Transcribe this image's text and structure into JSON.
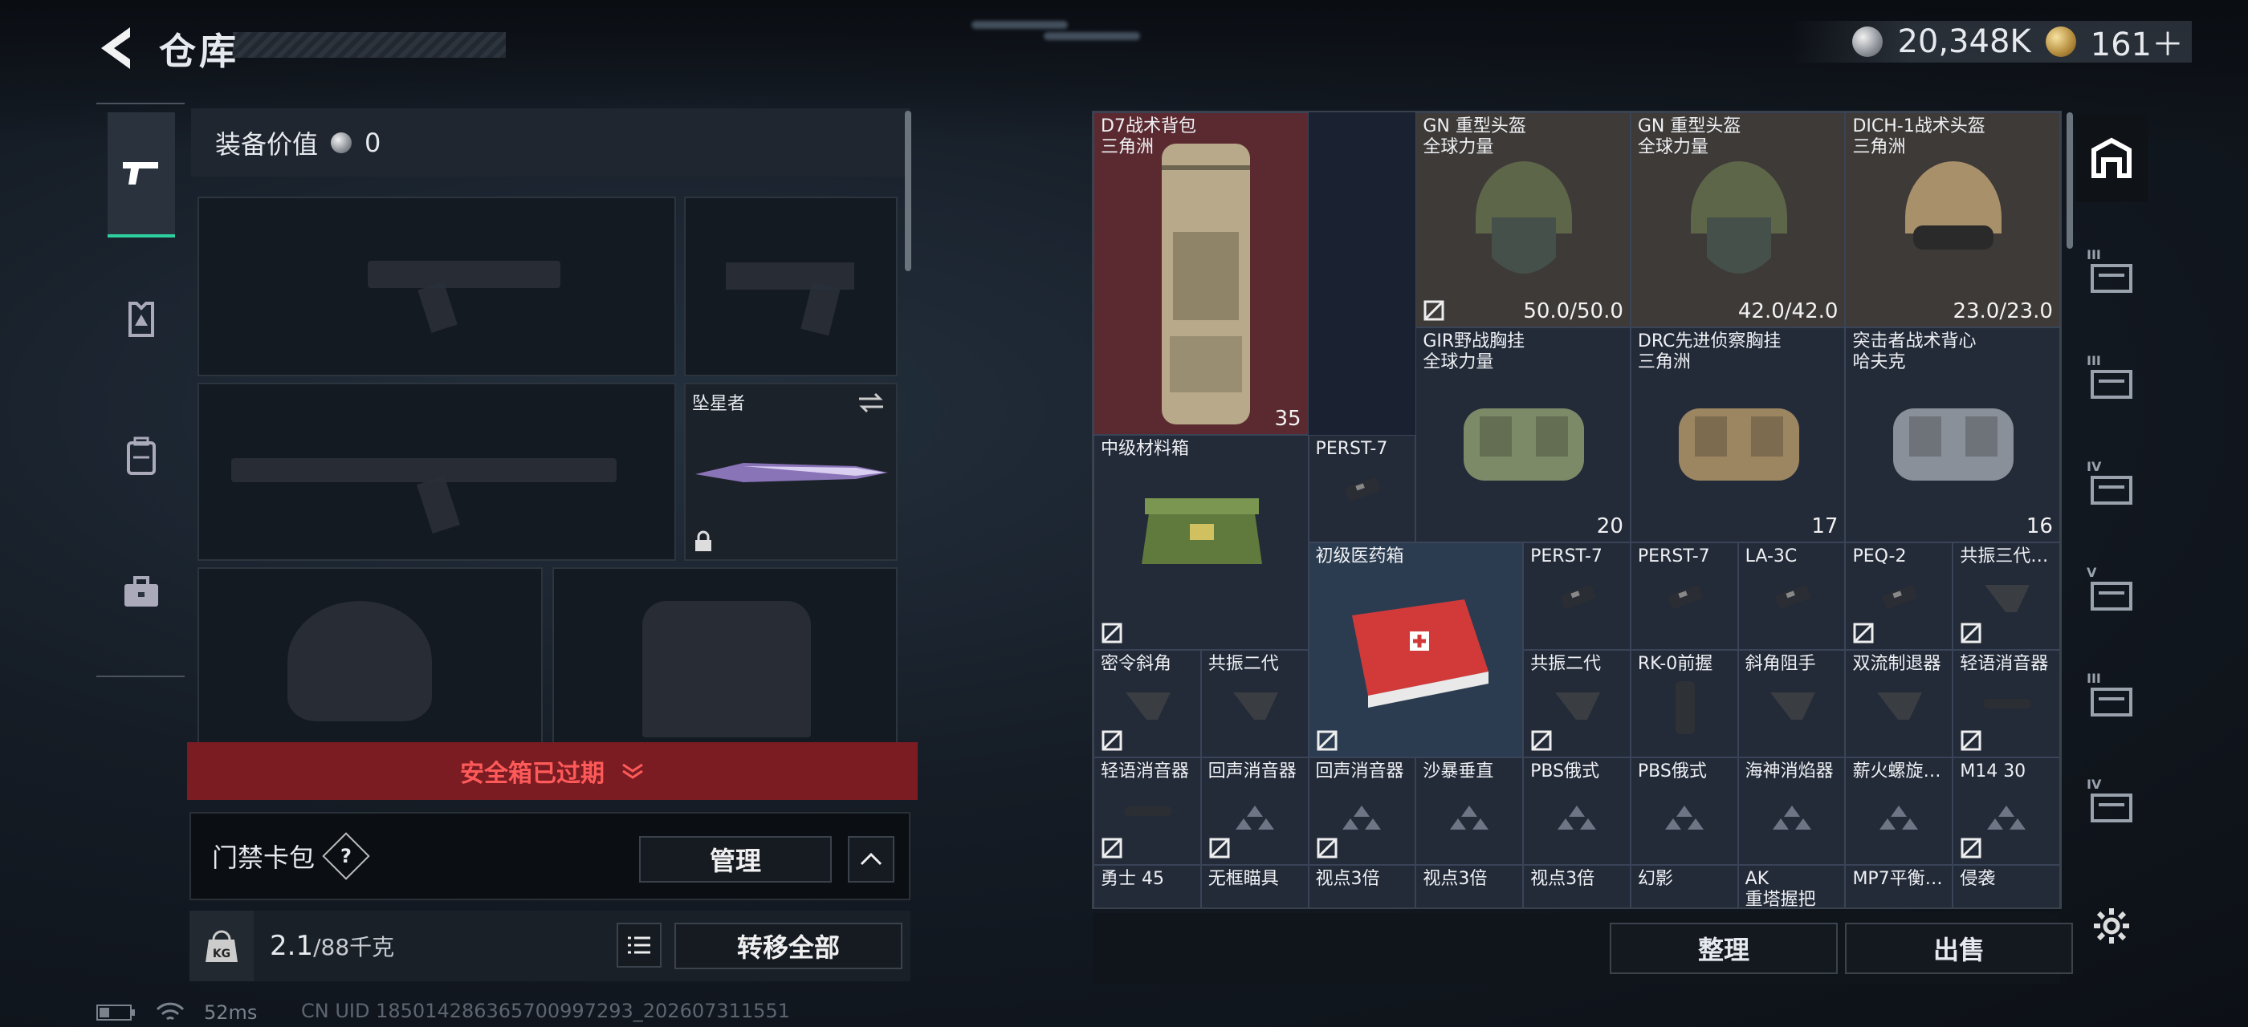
{
  "header": {
    "title": "仓库",
    "silver": "20,348K",
    "gold": "161＋"
  },
  "equipment": {
    "value_label": "装备价值",
    "value": "0",
    "melee_name": "坠星者",
    "safebox_status": "安全箱已过期",
    "card_pack_label": "门禁卡包",
    "help": "?",
    "manage": "管理",
    "weight": "2.1",
    "weight_max": "/88千克",
    "kg_icon": "KG",
    "transfer_all": "转移全部"
  },
  "inventory": {
    "items": [
      {
        "name": "D7战术背包",
        "sub": "三角洲",
        "val": "35"
      },
      {
        "name": "GN 重型头盔",
        "sub": "全球力量",
        "val": "50.0/50.0"
      },
      {
        "name": "GN 重型头盔",
        "sub": "全球力量",
        "val": "42.0/42.0"
      },
      {
        "name": "DICH-1战术头盔",
        "sub": "三角洲",
        "val": "23.0/23.0"
      },
      {
        "name": "GIR野战胸挂",
        "sub": "全球力量"
      },
      {
        "name": "DRC先进侦察胸挂",
        "sub": "三角洲",
        "val": "17"
      },
      {
        "name": "突击者战术背心",
        "sub": "哈夫克",
        "val": "16"
      },
      {
        "name": "中级材料箱"
      },
      {
        "name": "PERST-7"
      },
      {
        "name": "初级医药箱"
      },
      {
        "name": "PERST-7"
      },
      {
        "name": "PERST-7"
      },
      {
        "name": "LA-3C"
      },
      {
        "name": "PEQ-2"
      },
      {
        "name": "共振三代…"
      },
      {
        "name": "密令斜角"
      },
      {
        "name": "共振二代"
      },
      {
        "name": "共振二代"
      },
      {
        "name": "RK-0前握"
      },
      {
        "name": "斜角阻手"
      },
      {
        "name": "双流制退器"
      },
      {
        "name": "轻语消音器"
      },
      {
        "name": "轻语消音器"
      },
      {
        "name": "回声消音器"
      },
      {
        "name": "回声消音器"
      },
      {
        "name": "沙暴垂直"
      },
      {
        "name": "PBS俄式"
      },
      {
        "name": "PBS俄式"
      },
      {
        "name": "海神消焰器"
      },
      {
        "name": "薪火螺旋…"
      },
      {
        "name": "M14 30"
      },
      {
        "name": "勇士 45"
      },
      {
        "name": "无框瞄具"
      },
      {
        "name": "视点3倍"
      },
      {
        "name": "视点3倍"
      },
      {
        "name": "视点3倍"
      },
      {
        "name": "幻影"
      },
      {
        "name": "AK",
        "sub": "重塔握把"
      },
      {
        "name": "MP7平衡…"
      },
      {
        "name": "侵袭"
      }
    ],
    "gir_val": "20",
    "sort": "整理",
    "sell": "出售"
  },
  "right_nav": [
    "III",
    "III",
    "IV",
    "V",
    "III",
    "IV"
  ],
  "status": {
    "ping": "52ms",
    "uid": "CN UID 1850142863657009972​93_202607311551"
  }
}
